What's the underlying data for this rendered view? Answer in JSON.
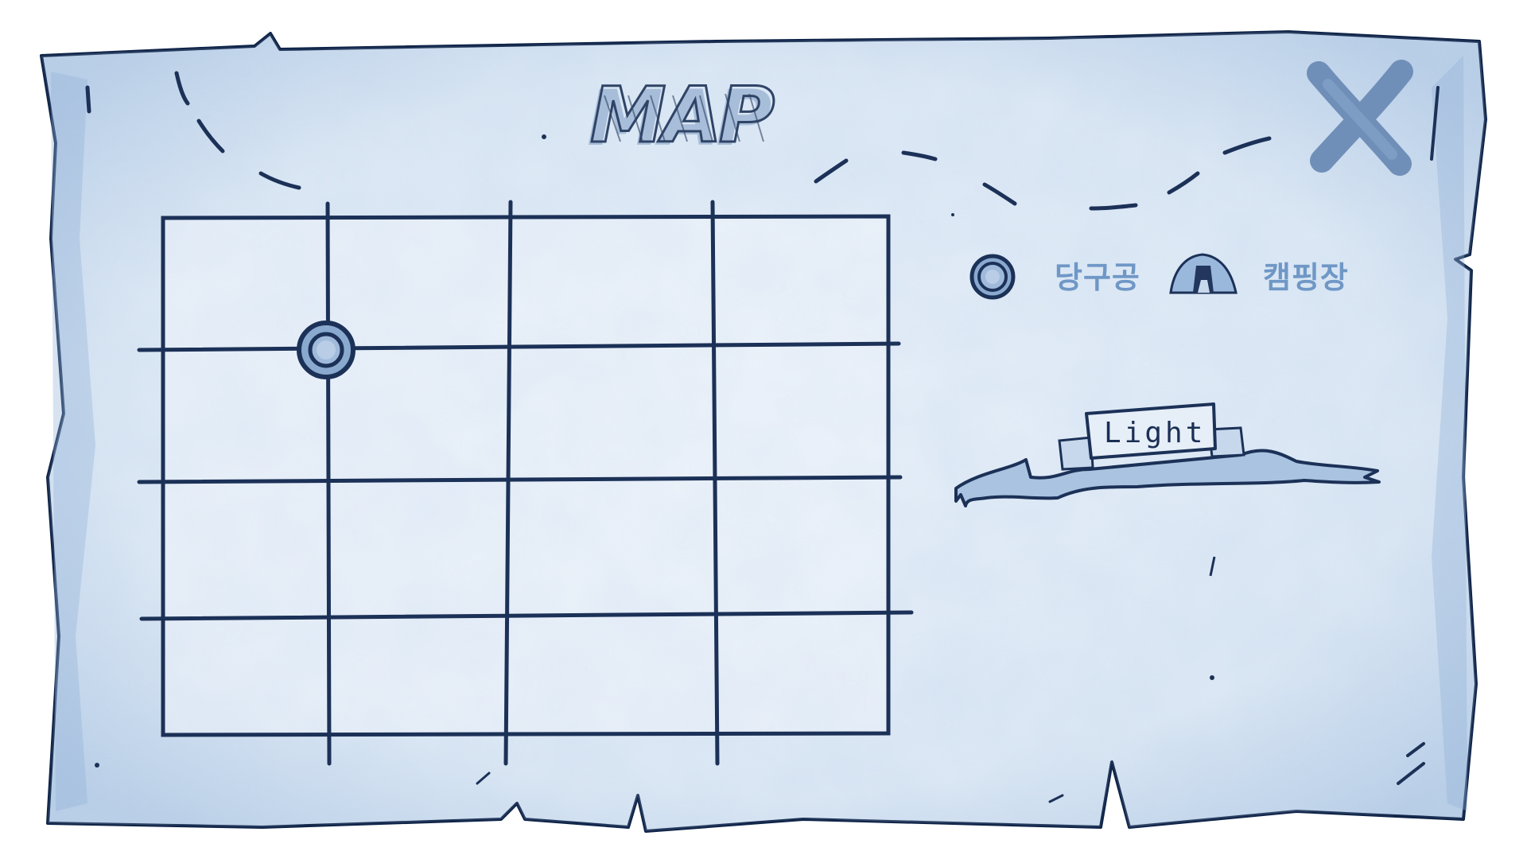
{
  "title": "MAP",
  "close_button": {
    "icon": "x-icon"
  },
  "grid": {
    "columns": 4,
    "rows": 4,
    "player_marker": {
      "icon": "billiard-ball-icon",
      "column": 1,
      "row": 1
    }
  },
  "legend": [
    {
      "icon": "billiard-ball-icon",
      "label": "당구공"
    },
    {
      "icon": "tent-icon",
      "label": "캠핑장"
    }
  ],
  "light_banner": {
    "label": "Light"
  },
  "colors": {
    "paper": "#dfe9f5",
    "paper_shade": "#a9c3e0",
    "ink": "#1c3157",
    "accent": "#6f97c6"
  }
}
